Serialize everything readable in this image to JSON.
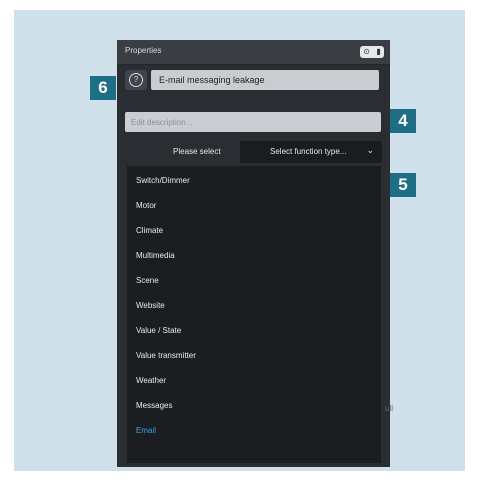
{
  "window": {
    "title": "Properties",
    "buttons": [
      "⊙",
      "▮"
    ]
  },
  "name_field": {
    "value": "E-mail messaging leakage",
    "help_icon": "?"
  },
  "description_field": {
    "placeholder": "Edit description..."
  },
  "function_select": {
    "label": "Please select",
    "value": "Select function type...",
    "chevron": "⌄"
  },
  "dropdown": {
    "items": [
      {
        "label": "Switch/Dimmer",
        "active": false
      },
      {
        "label": "Motor",
        "active": false
      },
      {
        "label": "Climate",
        "active": false
      },
      {
        "label": "Multimedia",
        "active": false
      },
      {
        "label": "Scene",
        "active": false
      },
      {
        "label": "Website",
        "active": false
      },
      {
        "label": "Value / State",
        "active": false
      },
      {
        "label": "Value transmitter",
        "active": false
      },
      {
        "label": "Weather",
        "active": false
      },
      {
        "label": "Messages",
        "active": false
      },
      {
        "label": "Email",
        "active": true
      }
    ]
  },
  "side_text": "ull",
  "badges": [
    "6",
    "4",
    "5"
  ],
  "colors": {
    "backdrop": "#cfe0ea",
    "panel": "#2a2d31",
    "dropdown": "#1b1d20",
    "badge": "#1e6e85",
    "active_item": "#3aa3e6"
  }
}
